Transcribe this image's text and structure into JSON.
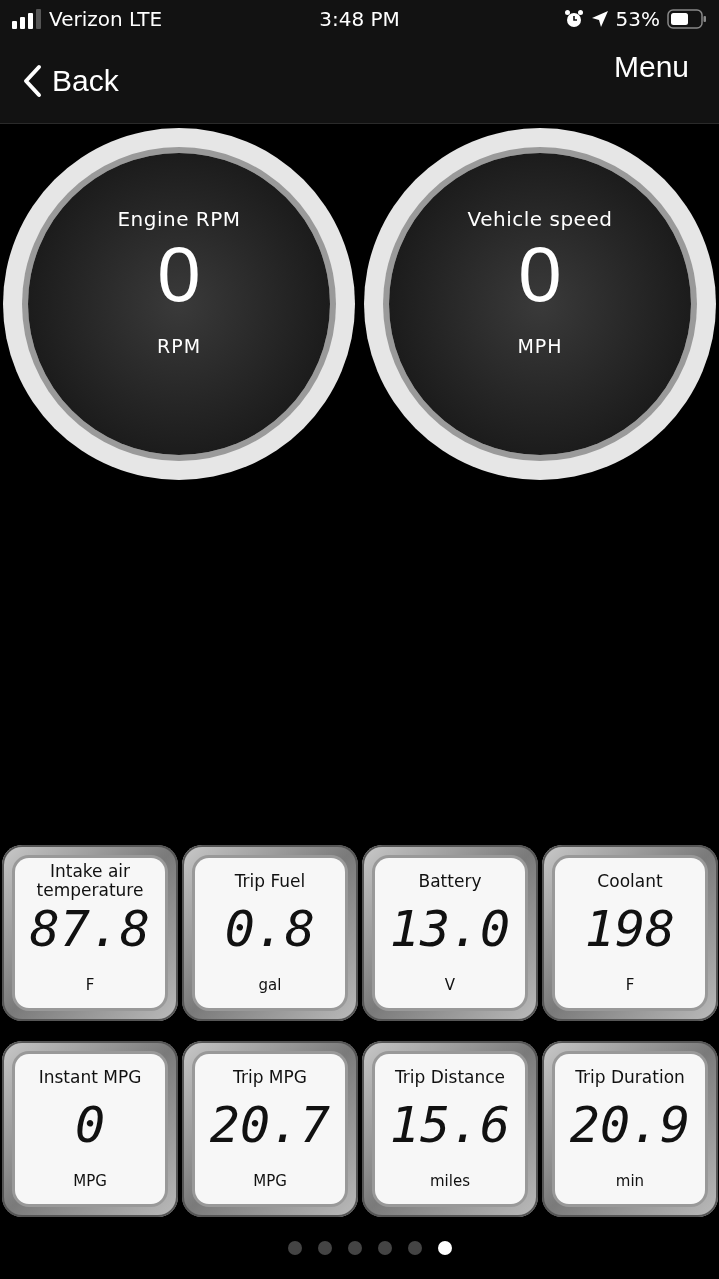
{
  "status_bar": {
    "carrier": "Verizon LTE",
    "time": "3:48 PM",
    "battery": "53%"
  },
  "nav": {
    "back": "Back",
    "menu": "Menu"
  },
  "gauges": [
    {
      "title": "Engine RPM",
      "value": "0",
      "unit": "RPM"
    },
    {
      "title": "Vehicle speed",
      "value": "0",
      "unit": "MPH"
    }
  ],
  "tiles": [
    {
      "title": "Intake air temperature",
      "value": "87.8",
      "unit": "F"
    },
    {
      "title": "Trip Fuel",
      "value": "0.8",
      "unit": "gal"
    },
    {
      "title": "Battery",
      "value": "13.0",
      "unit": "V"
    },
    {
      "title": "Coolant",
      "value": "198",
      "unit": "F"
    },
    {
      "title": "Instant MPG",
      "value": "0",
      "unit": "MPG"
    },
    {
      "title": "Trip MPG",
      "value": "20.7",
      "unit": "MPG"
    },
    {
      "title": "Trip Distance",
      "value": "15.6",
      "unit": "miles"
    },
    {
      "title": "Trip Duration",
      "value": "20.9",
      "unit": "min"
    }
  ],
  "page_dots": [
    {
      "selected": false
    },
    {
      "selected": false
    },
    {
      "selected": false
    },
    {
      "selected": false
    },
    {
      "selected": false
    },
    {
      "selected": true
    }
  ]
}
